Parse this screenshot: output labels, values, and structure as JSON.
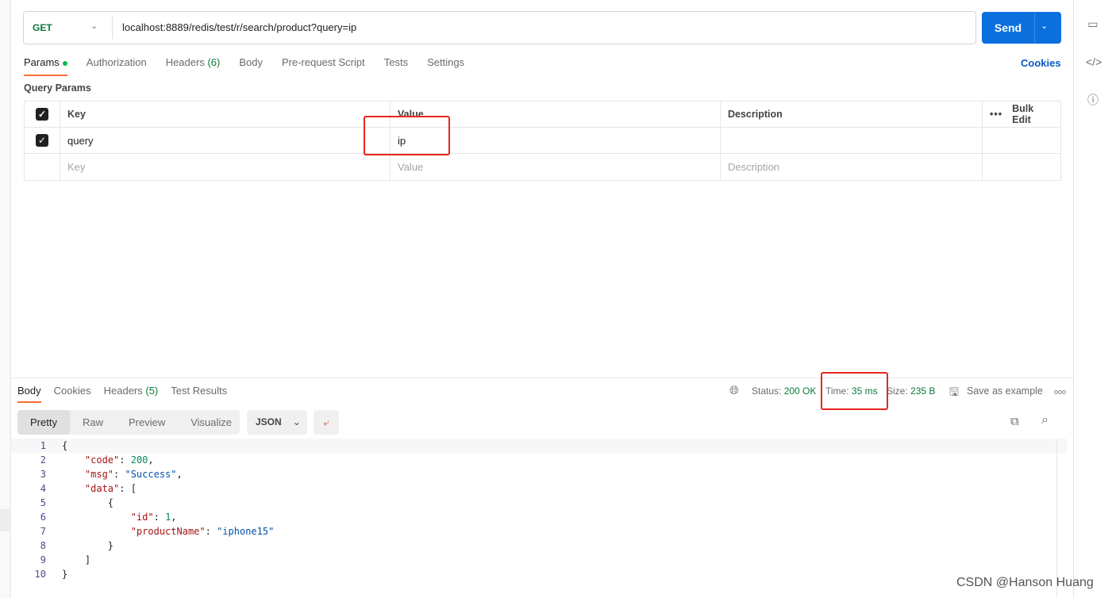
{
  "request": {
    "method": "GET",
    "url": "localhost:8889/redis/test/r/search/product?query=ip",
    "send_label": "Send"
  },
  "tabs": [
    {
      "label": "Params"
    },
    {
      "label": "Authorization"
    },
    {
      "label": "Headers",
      "count": "(6)"
    },
    {
      "label": "Body"
    },
    {
      "label": "Pre-request Script"
    },
    {
      "label": "Tests"
    },
    {
      "label": "Settings"
    }
  ],
  "cookies_label": "Cookies",
  "query_params": {
    "title": "Query Params",
    "headers": [
      "Key",
      "Value",
      "Description"
    ],
    "bulk_edit": "Bulk Edit",
    "rows": [
      {
        "checked": true,
        "key": "query",
        "value": "ip",
        "description": ""
      }
    ],
    "placeholders": {
      "key": "Key",
      "value": "Value",
      "description": "Description"
    }
  },
  "response": {
    "tabs": [
      {
        "label": "Body"
      },
      {
        "label": "Cookies"
      },
      {
        "label": "Headers",
        "count": "(5)"
      },
      {
        "label": "Test Results"
      }
    ],
    "status_label": "Status:",
    "status": "200 OK",
    "time_label": "Time:",
    "time": "35 ms",
    "size_label": "Size:",
    "size": "235 B",
    "save_example": "Save as example",
    "views": [
      "Pretty",
      "Raw",
      "Preview",
      "Visualize"
    ],
    "format": "JSON",
    "lines": [
      "1",
      "2",
      "3",
      "4",
      "5",
      "6",
      "7",
      "8",
      "9",
      "10"
    ]
  },
  "json_tokens": {
    "code_key": "\"code\"",
    "code_val": "200",
    "msg_key": "\"msg\"",
    "msg_val": "\"Success\"",
    "data_key": "\"data\"",
    "id_key": "\"id\"",
    "id_val": "1",
    "pn_key": "\"productName\"",
    "pn_val": "\"iphone15\""
  },
  "watermark": "CSDN @Hanson Huang",
  "colors": {
    "accent": "#ff6c37",
    "send": "#0b6fde",
    "success": "#0b7a3e",
    "highlight": "#e8251f"
  }
}
